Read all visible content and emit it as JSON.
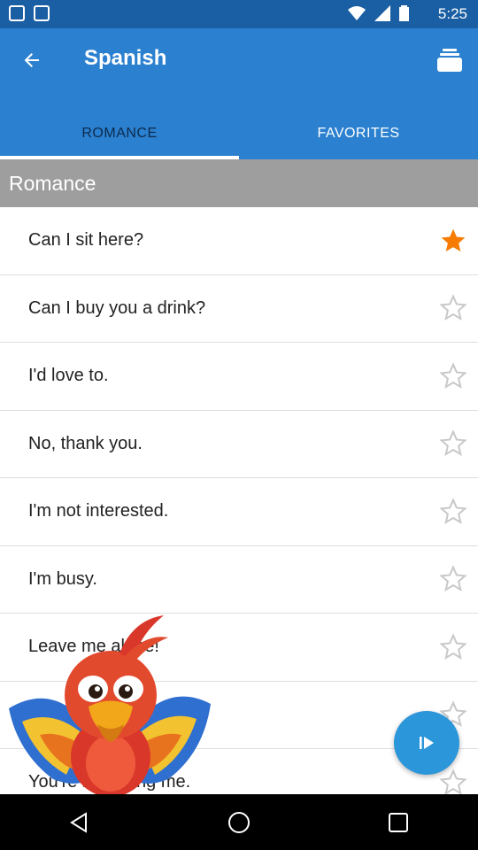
{
  "status_bar": {
    "time": "5:25"
  },
  "app_bar": {
    "title": "Spanish"
  },
  "tabs": [
    {
      "label": "ROMANCE",
      "active": true
    },
    {
      "label": "FAVORITES",
      "active": false
    }
  ],
  "section": {
    "title": "Romance"
  },
  "phrases": [
    {
      "text": "Can I sit here?",
      "favorite": true
    },
    {
      "text": "Can I buy you a drink?",
      "favorite": false
    },
    {
      "text": "I'd love to.",
      "favorite": false
    },
    {
      "text": "No, thank you.",
      "favorite": false
    },
    {
      "text": "I'm not interested.",
      "favorite": false
    },
    {
      "text": "I'm busy.",
      "favorite": false
    },
    {
      "text": "Leave me alone!",
      "favorite": false
    },
    {
      "text": "",
      "favorite": false
    },
    {
      "text": "You're bothering me.",
      "favorite": false
    }
  ],
  "colors": {
    "primary": "#2b80cf",
    "status": "#1a5fa3",
    "star_active": "#f57c00",
    "star_inactive": "#c8c8c8",
    "fab": "#2b96d9"
  },
  "icons": {
    "back": "arrow-left-icon",
    "inbox": "inbox-stack-icon",
    "play": "play-icon",
    "star": "star-icon"
  }
}
